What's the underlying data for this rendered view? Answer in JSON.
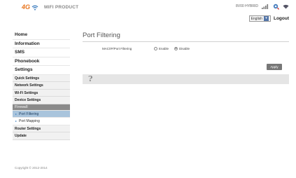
{
  "header": {
    "logo_text": "4G",
    "product": "MIFI PRODUCT",
    "network_status": "8V00 HYBRID",
    "language": "English",
    "logout_label": "Logout"
  },
  "sidebar": {
    "items": [
      {
        "label": "Home"
      },
      {
        "label": "Information"
      },
      {
        "label": "SMS"
      },
      {
        "label": "Phonebook"
      },
      {
        "label": "Settings"
      },
      {
        "label": "Quick Settings"
      },
      {
        "label": "Network Settings"
      },
      {
        "label": "Wi-Fi Settings"
      },
      {
        "label": "Device Settings"
      },
      {
        "label": "Firewall"
      },
      {
        "label": "Port Filtering"
      },
      {
        "label": "Port Mapping"
      },
      {
        "label": "Router Settings"
      },
      {
        "label": "Update"
      }
    ]
  },
  "main": {
    "title": "Port Filtering",
    "option_label": "MAC/IP/Port Filtering",
    "enable_label": "Enable",
    "disable_label": "Disable",
    "selected": "Disable",
    "apply_label": "Apply",
    "help_symbol": "?"
  },
  "footer": {
    "copyright": "Copyright © 2012-2014"
  },
  "colors": {
    "accent_orange": "#e8731a",
    "accent_blue": "#3f7fc0",
    "selected_item_bg": "#a9c4dc",
    "active_group_bg": "#8a8a8a"
  }
}
